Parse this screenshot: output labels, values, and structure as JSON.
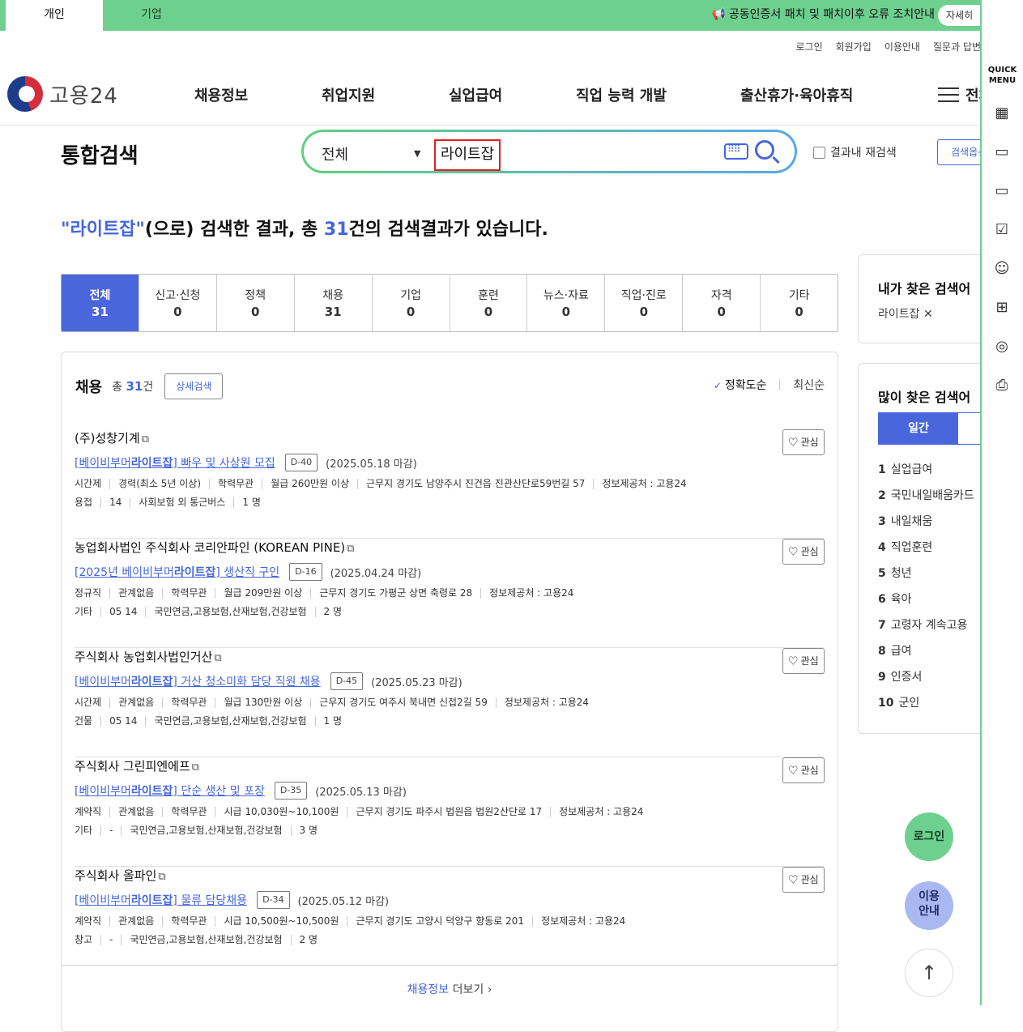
{
  "topbar": {
    "tab_personal": "개인",
    "tab_company": "기업",
    "notice": "공동인증서 패치 및 패치이후 오류 조치안내",
    "detail_label": "자세히"
  },
  "util_links": [
    "로그인",
    "회원가입",
    "이용안내",
    "질문과 답변"
  ],
  "logo_text": "고용24",
  "gnb": [
    "채용정보",
    "취업지원",
    "실업급여",
    "직업 능력 개발",
    "출산휴가·육아휴직"
  ],
  "all_menu_label": "전체",
  "search": {
    "title": "통합검색",
    "category": "전체",
    "query": "라이트잡",
    "refine_label": "결과내 재검색",
    "help_label": "검색옵션"
  },
  "summary": {
    "keyword": "\"라이트잡\"",
    "mid": "(으로) 검색한 결과, 총 ",
    "count": "31",
    "tail": "건의 검색결과가 있습니다."
  },
  "categories": [
    {
      "label": "전체",
      "count": "31"
    },
    {
      "label": "신고·신청",
      "count": "0"
    },
    {
      "label": "정책",
      "count": "0"
    },
    {
      "label": "채용",
      "count": "31"
    },
    {
      "label": "기업",
      "count": "0"
    },
    {
      "label": "훈련",
      "count": "0"
    },
    {
      "label": "뉴스·자료",
      "count": "0"
    },
    {
      "label": "직업·진로",
      "count": "0"
    },
    {
      "label": "자격",
      "count": "0"
    },
    {
      "label": "기타",
      "count": "0"
    }
  ],
  "results": {
    "section_title": "채용",
    "total_prefix": "총",
    "total": "31",
    "total_suffix": "건",
    "detail_search": "상세검색",
    "sort_on": "정확도순",
    "sort_off": "최신순",
    "fav_label": "관심",
    "jobs": [
      {
        "company": "(주)성창기계",
        "title_pre": "[베이비부머",
        "title_kw": "라이트잡",
        "title_post": "] 빠우 및 사상원 모집",
        "dday": "D-40",
        "deadline": "(2025.05.18 마감)",
        "meta1": [
          "시간제",
          "경력(최소 5년 이상)",
          "학력무관",
          "월급 260만원 이상",
          "근무지 경기도 남양주시 진건읍 진관산단로59번길 57",
          "정보제공처 : 고용24"
        ],
        "meta2": [
          "용접",
          "14",
          "사회보험 외 통근버스",
          "1 명"
        ]
      },
      {
        "company": "농업회사법인 주식회사 코리안파인 (KOREAN PINE)",
        "title_pre": "[2025년 베이비부머",
        "title_kw": "라이트잡",
        "title_post": "] 생산직 구인",
        "dday": "D-16",
        "deadline": "(2025.04.24 마감)",
        "meta1": [
          "정규직",
          "관계없음",
          "학력무관",
          "월급 209만원 이상",
          "근무지 경기도 가평군 상면 축령로 28",
          "정보제공처 : 고용24"
        ],
        "meta2": [
          "기타",
          "05 14",
          "국민연금,고용보험,산재보험,건강보험",
          "2 명"
        ]
      },
      {
        "company": "주식회사 농업회사법인거산",
        "title_pre": "[베이비부머",
        "title_kw": "라이트잡",
        "title_post": "] 거산 청소미화 담당 직원 채용",
        "dday": "D-45",
        "deadline": "(2025.05.23 마감)",
        "meta1": [
          "시간제",
          "관계없음",
          "학력무관",
          "월급 130만원 이상",
          "근무지 경기도 여주시 북내면 신접2길 59",
          "정보제공처 : 고용24"
        ],
        "meta2": [
          "건물",
          "05 14",
          "국민연금,고용보험,산재보험,건강보험",
          "1 명"
        ]
      },
      {
        "company": "주식회사 그린피엔에프",
        "title_pre": "[베이비부머",
        "title_kw": "라이트잡",
        "title_post": "] 단순 생산 및 포장",
        "dday": "D-35",
        "deadline": "(2025.05.13 마감)",
        "meta1": [
          "계약직",
          "관계없음",
          "학력무관",
          "시급 10,030원~10,100원",
          "근무지 경기도 파주시 법원읍 법원2산단로 17",
          "정보제공처 : 고용24"
        ],
        "meta2": [
          "기타",
          "-",
          "국민연금,고용보험,산재보험,건강보험",
          "3 명"
        ]
      },
      {
        "company": "주식회사 올파인",
        "title_pre": "[베이비부머",
        "title_kw": "라이트잡",
        "title_post": "] 물류 담당채용",
        "dday": "D-34",
        "deadline": "(2025.05.12 마감)",
        "meta1": [
          "계약직",
          "관계없음",
          "학력무관",
          "시급 10,500원~10,500원",
          "근무지 경기도 고양시 덕양구 향동로 201",
          "정보제공처 : 고용24"
        ],
        "meta2": [
          "창고",
          "-",
          "국민연금,고용보험,산재보험,건강보험",
          "2 명"
        ]
      }
    ],
    "more_blue": "채용정보",
    "more_text": "더보기"
  },
  "my_search": {
    "title": "내가 찾은 검색어",
    "keyword": "라이트잡"
  },
  "popular": {
    "title": "많이 찾은 검색어",
    "period_on": "일간",
    "items": [
      "실업급여",
      "국민내일배움카드",
      "내일채움",
      "직업훈련",
      "청년",
      "육아",
      "고령자 계속고용",
      "급여",
      "인증서",
      "군인"
    ]
  },
  "floating": {
    "login": "로그인",
    "guide_line1": "이용",
    "guide_line2": "안내"
  },
  "quick_menu": {
    "title_line1": "QUICK",
    "title_line2": "MENU",
    "icons": [
      "building-icon",
      "chat-icon",
      "monitor-icon",
      "checklist-icon",
      "smile-icon",
      "calculator-icon",
      "coins-icon",
      "printer-icon"
    ]
  },
  "colors": {
    "brand_green": "#6dd08e",
    "accent_blue": "#4466dd",
    "active_tab": "#4a66dc"
  }
}
